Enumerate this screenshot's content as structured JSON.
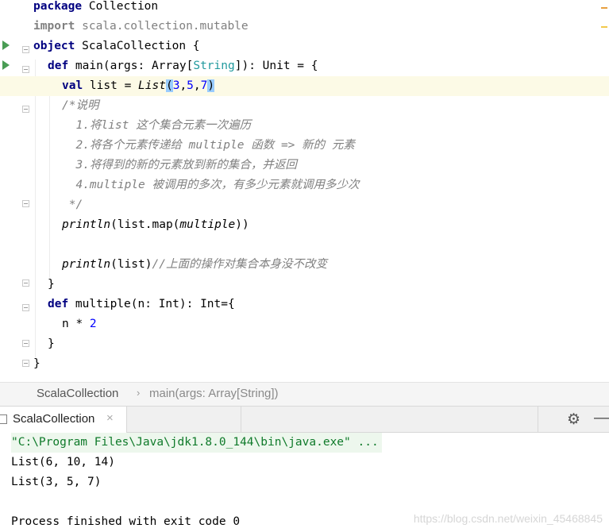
{
  "editor": {
    "lines": {
      "l1": {
        "kw": "package",
        "rest": " Collection"
      },
      "l2": {
        "kw": "import",
        "rest": " scala.collection.mutable"
      },
      "l3": {
        "kw": "object",
        "rest": " ScalaCollection {"
      },
      "l4": {
        "kw": "def",
        "a": " main(args: Array[",
        "b": "String",
        "c": "]): Unit = {"
      },
      "l5": {
        "kw": "val",
        "a": " list = ",
        "b": "List",
        "c": "(",
        "d": "3",
        "e": ",",
        "f": "5",
        "g": ",",
        "h": "7",
        "i": ")"
      },
      "l6": "/*说明",
      "l7": "  1.将list 这个集合元素一次遍历",
      "l8": "  2.将各个元素传递给 multiple 函数 => 新的 元素",
      "l9": "  3.将得到的新的元素放到新的集合，并返回",
      "l10": "  4.multiple 被调用的多次，有多少元素就调用多少次",
      "l11": " */",
      "l12": {
        "a": "println",
        "b": "(list.map(",
        "c": "multiple",
        "d": "))"
      },
      "l14": {
        "a": "println",
        "b": "(list)",
        "c": "//上面的操作对集合本身没不改变"
      },
      "l15": "}",
      "l16": {
        "kw": "def",
        "rest": " multiple(n: Int): Int={"
      },
      "l17": {
        "a": "n * ",
        "b": "2"
      },
      "l18": "}",
      "l19": "}"
    }
  },
  "breadcrumb": {
    "object": "ScalaCollection",
    "separator": "›",
    "method": "main(args: Array[String])"
  },
  "run_panel": {
    "tab_label": "ScalaCollection",
    "close_glyph": "×",
    "gear_glyph": "⚙",
    "minimize_glyph": "—"
  },
  "console": {
    "command": "\"C:\\Program Files\\Java\\jdk1.8.0_144\\bin\\java.exe\" ...",
    "output_1": "List(6, 10, 14)",
    "output_2": "List(3, 5, 7)",
    "exit": "Process finished with exit code 0"
  },
  "watermark": "https://blog.csdn.net/weixin_45468845",
  "colors": {
    "keyword": "#000080",
    "comment": "#808080",
    "number": "#0000ff",
    "type_highlight": "#20999d",
    "run_arrow": "#499c54",
    "current_line": "#fcfae6",
    "console_command": "#0f7a2a"
  }
}
